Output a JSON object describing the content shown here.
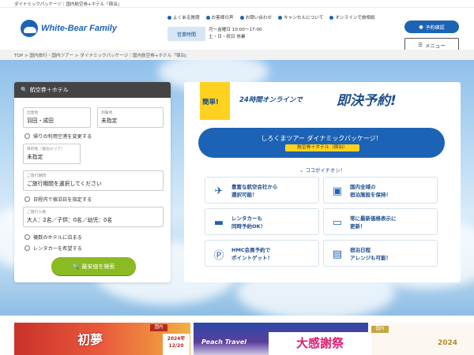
{
  "topstrip": {
    "text": "ダイナミックパッケージ｜国内航空券+ホテル「宿泊」"
  },
  "header": {
    "logo_text": "White-Bear Family",
    "links": [
      "よくある質問",
      "お客様の声",
      "お問い合わせ",
      "キャンセルについて",
      "オンラインで旅相談"
    ],
    "hours_label": "営業時間",
    "hours_line1": "月～金曜日 10:00～17:00",
    "hours_line2": "土・日・祝日 休業",
    "reserve_label": "予約確認",
    "menu_label": "メニュー"
  },
  "breadcrumb": "TOP > 国内旅行・国内ツアー > ダイナミックパッケージ｜国内航空券+ホテル「宿泊」",
  "search": {
    "title": "航空券＋ホテル",
    "departure_label": "出発地",
    "departure_value": "羽田・成田",
    "arrival_label": "到着地",
    "arrival_value": "未指定",
    "return_airport_label": "帰りの利用空港を変更する",
    "destination_label": "目的地（宿泊エリア）",
    "destination_value": "未指定",
    "period_label": "ご旅行期間",
    "period_value": "ご旅行期間を選択してください",
    "domestic_date_label": "日程内で宿泊日を指定する",
    "pax_label": "ご旅行人数",
    "pax_value": "大人：2名／子供：0名／幼児：0名",
    "multi_hotel_label": "複数のホテルに泊まる",
    "rental_label": "レンタカーを希望する",
    "submit_label": "最安値を検索"
  },
  "promo": {
    "easy": "簡単!",
    "online": "24時間オンラインで",
    "instant": "即決予約!",
    "pill_line1": "しろくまツアー ダイナミックパッケージ！",
    "pill_line2": "航空券＋ホテル（宿泊）",
    "sub": "ココがイチオシ！",
    "features": [
      {
        "line1": "豊富な航空会社から",
        "line2": "選択可能！"
      },
      {
        "line1": "国内全域の",
        "line2": "宿泊施設を保持！"
      },
      {
        "line1": "レンタカーも",
        "line2": "同時予約OK！"
      },
      {
        "line1": "常に最新価格表示に",
        "line2": "更新！"
      },
      {
        "line1": "HMC会員予約で",
        "line2": "ポイントゲット！"
      },
      {
        "line1": "宿泊日程",
        "line2": "アレンジも可能！"
      }
    ]
  },
  "banners": {
    "b1_title": "初夢",
    "b1_tag": "国内",
    "b1_year": "2024年 12/20",
    "b2_brand": "Peach Travel",
    "b2_title": "大感謝祭",
    "b3_tag": "国内",
    "b3_year": "2024"
  },
  "colors": {
    "primary": "#1d63b5",
    "accent": "#ffd21f",
    "button_green": "#8bbb22"
  }
}
